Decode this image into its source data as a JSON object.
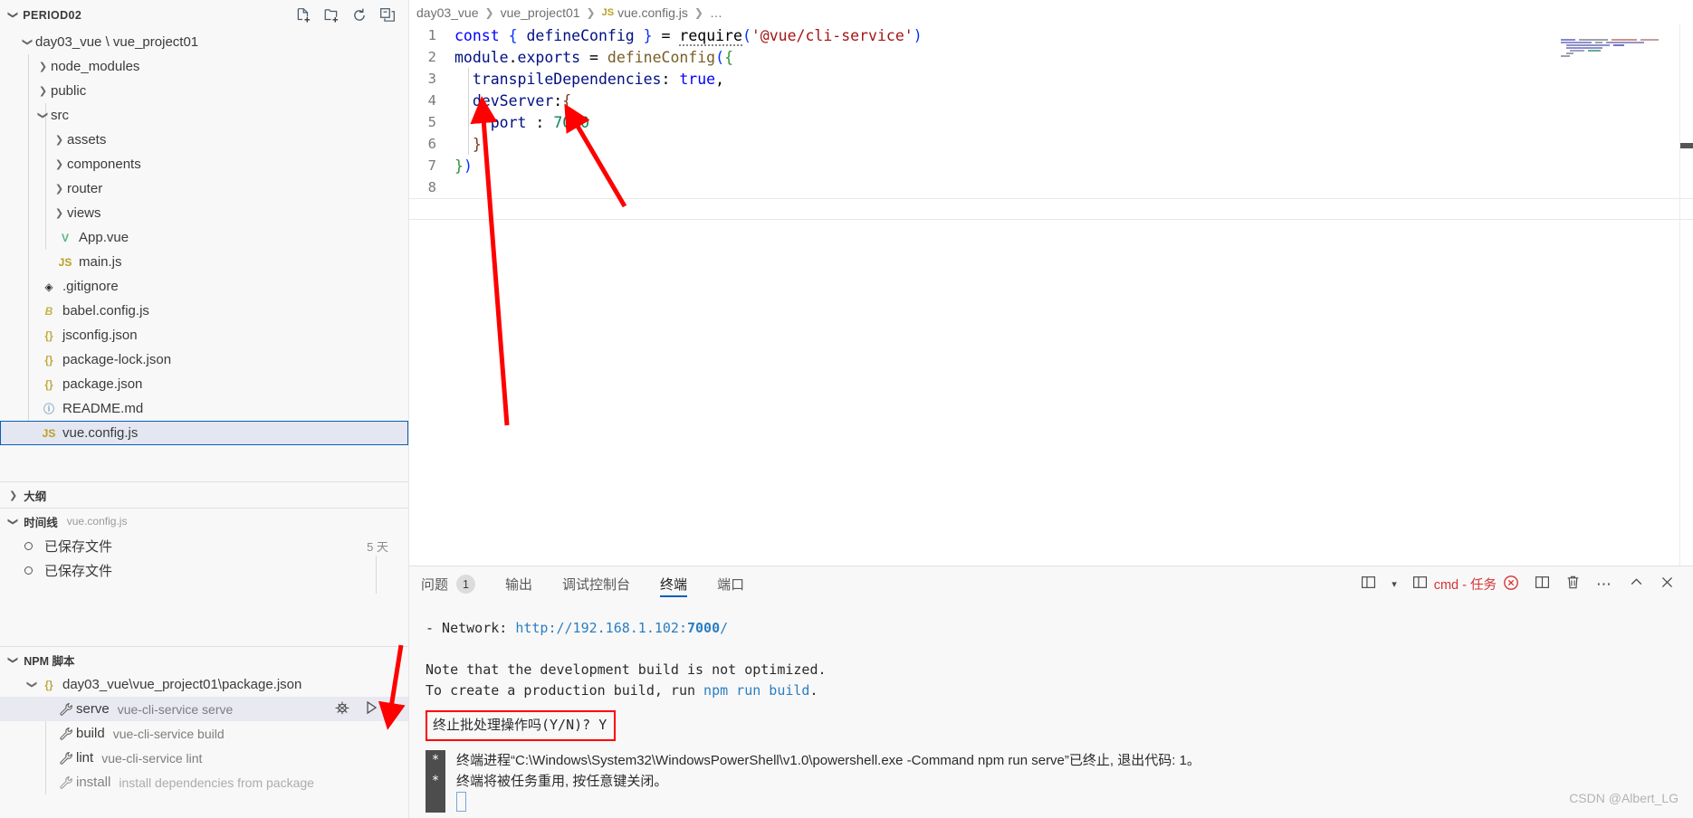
{
  "sidebar": {
    "header": {
      "title": "PERIOD02",
      "chevron": "chevron-down",
      "actions": [
        "new-file-icon",
        "new-folder-icon",
        "refresh-icon",
        "collapse-all-icon"
      ]
    },
    "project_root": "day03_vue \\ vue_project01",
    "tree": [
      {
        "label": "node_modules",
        "type": "folder",
        "expanded": false,
        "depth": 1
      },
      {
        "label": "public",
        "type": "folder",
        "expanded": false,
        "depth": 1
      },
      {
        "label": "src",
        "type": "folder",
        "expanded": true,
        "depth": 1
      },
      {
        "label": "assets",
        "type": "folder",
        "expanded": false,
        "depth": 2
      },
      {
        "label": "components",
        "type": "folder",
        "expanded": false,
        "depth": 2
      },
      {
        "label": "router",
        "type": "folder",
        "expanded": false,
        "depth": 2
      },
      {
        "label": "views",
        "type": "folder",
        "expanded": false,
        "depth": 2
      },
      {
        "label": "App.vue",
        "type": "vue",
        "depth": 2
      },
      {
        "label": "main.js",
        "type": "js",
        "depth": 2
      },
      {
        "label": ".gitignore",
        "type": "git",
        "depth": 1
      },
      {
        "label": "babel.config.js",
        "type": "babel",
        "depth": 1
      },
      {
        "label": "jsconfig.json",
        "type": "json",
        "depth": 1
      },
      {
        "label": "package-lock.json",
        "type": "json",
        "depth": 1
      },
      {
        "label": "package.json",
        "type": "json",
        "depth": 1
      },
      {
        "label": "README.md",
        "type": "md",
        "depth": 1
      },
      {
        "label": "vue.config.js",
        "type": "js",
        "depth": 1,
        "selected": true
      }
    ],
    "outline": {
      "label": "大纲",
      "expanded": false
    },
    "timeline": {
      "label": "时间线",
      "file": "vue.config.js",
      "expanded": true,
      "items": [
        {
          "label": "已保存文件",
          "when": "5 天"
        },
        {
          "label": "已保存文件",
          "when": ""
        }
      ]
    },
    "npm": {
      "label": "NPM 脚本",
      "package": "day03_vue\\vue_project01\\package.json",
      "scripts": [
        {
          "name": "serve",
          "desc": "vue-cli-service serve",
          "active": true,
          "actions": [
            "debug-icon",
            "run-icon"
          ]
        },
        {
          "name": "build",
          "desc": "vue-cli-service build",
          "active": false
        },
        {
          "name": "lint",
          "desc": "vue-cli-service lint",
          "active": false
        },
        {
          "name": "install",
          "desc": "install dependencies from package",
          "active": false,
          "dim": true
        }
      ]
    }
  },
  "editor": {
    "breadcrumb": [
      "day03_vue",
      "vue_project01",
      "vue.config.js",
      "…"
    ],
    "breadcrumb_file_icon": "js-file-icon",
    "lines": [
      {
        "n": "1",
        "text": "const { defineConfig } = require('@vue/cli-service')"
      },
      {
        "n": "2",
        "text": "module.exports = defineConfig({"
      },
      {
        "n": "3",
        "text": "  transpileDependencies: true,"
      },
      {
        "n": "4",
        "text": "  devServer:{"
      },
      {
        "n": "5",
        "text": "    port : 7000"
      },
      {
        "n": "6",
        "text": "  }"
      },
      {
        "n": "7",
        "text": "})"
      },
      {
        "n": "8",
        "text": ""
      }
    ]
  },
  "panel": {
    "tabs": [
      {
        "label": "问题",
        "badge": "1",
        "selected": false
      },
      {
        "label": "输出",
        "badge": "",
        "selected": false
      },
      {
        "label": "调试控制台",
        "badge": "",
        "selected": false
      },
      {
        "label": "终端",
        "badge": "",
        "selected": true
      },
      {
        "label": "端口",
        "badge": "",
        "selected": false
      }
    ],
    "actions": {
      "split_layout": "panel-layout-icon",
      "chevron": "chevron-down-icon",
      "terminal_icon": "terminal-split-icon",
      "terminal_name": "cmd - 任务",
      "kill_icon": "kill-terminal-icon",
      "split_terminal": "split-terminal-icon",
      "trash": "trash-icon",
      "more": "more-actions-icon",
      "maximize": "chevron-up-icon",
      "close": "close-icon"
    },
    "terminal": {
      "network_prefix": "- Network: ",
      "network_url_a": "http://192.168.1.102:",
      "network_port": "7000",
      "network_url_b": "/",
      "note_line1": "Note that the development build is not optimized.",
      "note_line2_a": "To create a production build, run ",
      "note_line2_cmd": "npm run build",
      "note_line2_b": ".",
      "prompt_highlight": "终止批处理操作吗(Y/N)? Y",
      "sys_line1": "终端进程“C:\\Windows\\System32\\WindowsPowerShell\\v1.0\\powershell.exe -Command npm run serve”已终止, 退出代码: 1。",
      "sys_line2": "终端将被任务重用, 按任意键关闭。",
      "star": "*"
    }
  },
  "watermark": "CSDN @Albert_LG",
  "colors": {
    "accent": "#005fb8",
    "annotation_red": "#ff0000",
    "selection": "#e4e6f1",
    "terminal_red": "#d43333"
  }
}
